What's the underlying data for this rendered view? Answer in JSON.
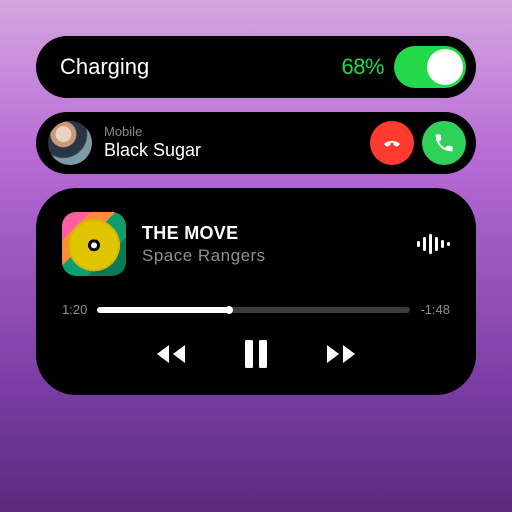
{
  "battery": {
    "status_label": "Charging",
    "percent_text": "68%",
    "toggle_on": true
  },
  "call": {
    "type_label": "Mobile",
    "caller_name": "Black Sugar"
  },
  "media": {
    "track_title": "THE MOVE",
    "artist": "Space  Rangers",
    "elapsed": "1:20",
    "remaining": "-1:48",
    "progress_pct": 42
  },
  "colors": {
    "green": "#22d94a",
    "red": "#ff3b30",
    "accept_green": "#30d158"
  }
}
